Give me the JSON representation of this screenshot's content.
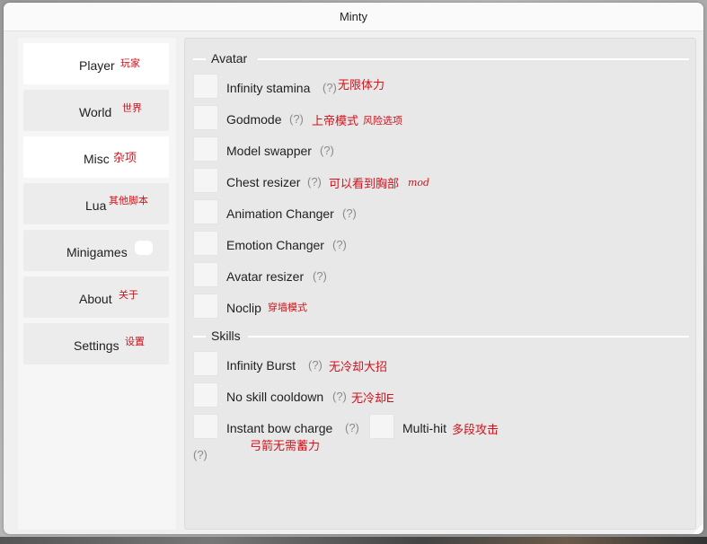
{
  "window": {
    "title": "Minty"
  },
  "sidebar": {
    "items": [
      {
        "label": "Player",
        "note": "玩家",
        "active": true
      },
      {
        "label": "World",
        "note": "世界",
        "active": false
      },
      {
        "label": "Misc",
        "note": "杂项",
        "active": true
      },
      {
        "label": "Lua",
        "note": "其他脚本",
        "active": false
      },
      {
        "label": "Minigames",
        "note": "",
        "active": false
      },
      {
        "label": "About",
        "note": "关于",
        "active": false
      },
      {
        "label": "Settings",
        "note": "设置",
        "active": false
      }
    ]
  },
  "help_mark": "(?)",
  "sections": {
    "avatar": {
      "title": "Avatar",
      "options": [
        {
          "label": "Infinity stamina",
          "note": "无限体力"
        },
        {
          "label": "Godmode",
          "note": "上帝模式",
          "note2": "风险选项"
        },
        {
          "label": "Model swapper"
        },
        {
          "label": "Chest resizer",
          "note": "可以看到胸部",
          "note2": "mod"
        },
        {
          "label": "Animation Changer"
        },
        {
          "label": "Emotion Changer"
        },
        {
          "label": "Avatar resizer"
        },
        {
          "label": "Noclip",
          "note": "穿墙模式"
        }
      ]
    },
    "skills": {
      "title": "Skills",
      "options": [
        {
          "label": "Infinity Burst",
          "note": "无冷却大招"
        },
        {
          "label": "No skill cooldown",
          "note": "无冷却E"
        },
        {
          "label": "Instant bow charge",
          "note": "弓箭无需蓄力"
        },
        {
          "label": "Multi-hit",
          "note": "多段攻击"
        }
      ]
    }
  }
}
